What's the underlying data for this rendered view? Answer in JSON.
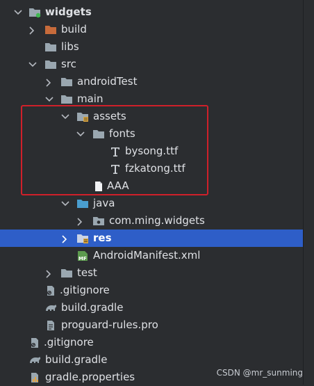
{
  "tree": {
    "rows": [
      {
        "label": "widgets",
        "icon": "module-folder-icon",
        "chevron": "down",
        "bold": true
      },
      {
        "label": "build",
        "icon": "excluded-folder-icon",
        "chevron": "right"
      },
      {
        "label": "libs",
        "icon": "folder-icon",
        "chevron": ""
      },
      {
        "label": "src",
        "icon": "folder-icon",
        "chevron": "down"
      },
      {
        "label": "androidTest",
        "icon": "folder-icon",
        "chevron": "right"
      },
      {
        "label": "main",
        "icon": "folder-icon",
        "chevron": "down"
      },
      {
        "label": "assets",
        "icon": "assets-folder-icon",
        "chevron": "down"
      },
      {
        "label": "fonts",
        "icon": "folder-icon",
        "chevron": "down"
      },
      {
        "label": "bysong.ttf",
        "icon": "font-file-icon",
        "chevron": ""
      },
      {
        "label": "fzkatong.ttf",
        "icon": "font-file-icon",
        "chevron": ""
      },
      {
        "label": "AAA",
        "icon": "text-file-icon",
        "chevron": ""
      },
      {
        "label": "java",
        "icon": "source-folder-icon",
        "chevron": "down"
      },
      {
        "label": "com.ming.widgets",
        "icon": "package-icon",
        "chevron": "right"
      },
      {
        "label": "res",
        "icon": "resource-folder-icon",
        "chevron": "right",
        "selected": true
      },
      {
        "label": "AndroidManifest.xml",
        "icon": "manifest-file-icon",
        "chevron": ""
      },
      {
        "label": "test",
        "icon": "folder-icon",
        "chevron": "right"
      },
      {
        "label": ".gitignore",
        "icon": "gitignore-file-icon",
        "chevron": ""
      },
      {
        "label": "build.gradle",
        "icon": "gradle-icon",
        "chevron": ""
      },
      {
        "label": "proguard-rules.pro",
        "icon": "config-file-icon",
        "chevron": ""
      },
      {
        "label": ".gitignore",
        "icon": "gitignore-file-icon",
        "chevron": ""
      },
      {
        "label": "build.gradle",
        "icon": "gradle-icon",
        "chevron": ""
      },
      {
        "label": "gradle.properties",
        "icon": "properties-file-icon",
        "chevron": ""
      }
    ]
  },
  "watermark": "CSDN @mr_sunming",
  "colors": {
    "background": "#2b2d30",
    "selection": "#2e5ec8",
    "highlight_box": "#d0202a",
    "text": "#dfe1e5"
  }
}
